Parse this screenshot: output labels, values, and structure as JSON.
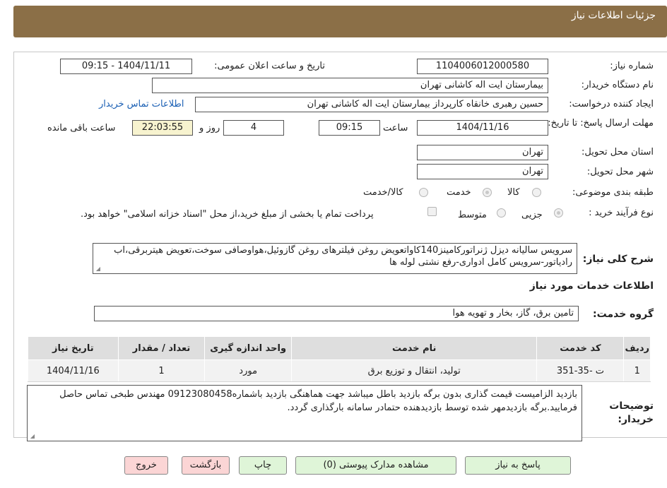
{
  "header": {
    "title": "جزئیات اطلاعات نیاز"
  },
  "form": {
    "need_number_label": "شماره نیاز:",
    "need_number": "1104006012000580",
    "announce_label": "تاریخ و ساعت اعلان عمومی:",
    "announce_value": "1404/11/11 - 09:15",
    "buyer_org_label": "نام دستگاه خریدار:",
    "buyer_org": "بیمارستان ایت اله کاشانی تهران",
    "requester_label": "ایجاد کننده درخواست:",
    "requester": "حسین رهبری خانقاه کارپرداز بیمارستان ایت اله کاشانی تهران",
    "contact_link": "اطلاعات تماس خریدار",
    "deadline_label": "مهلت ارسال پاسخ: تا تاریخ:",
    "deadline_date": "1404/11/16",
    "time_label": "ساعت",
    "deadline_time": "09:15",
    "days_value": "4",
    "days_label": "روز و",
    "remaining_time": "22:03:55",
    "remaining_label": "ساعت باقی مانده",
    "province_label": "استان محل تحویل:",
    "province": "تهران",
    "city_label": "شهر محل تحویل:",
    "city": "تهران",
    "category_label": "طبقه بندی موضوعی:",
    "category_options": [
      "کالا",
      "خدمت",
      "کالا/خدمت"
    ],
    "category_selected": "خدمت",
    "process_label": "نوع فرآیند خرید :",
    "process_options": [
      "جزیی",
      "متوسط"
    ],
    "process_selected": "جزیی",
    "payment_note": "پرداخت تمام یا بخشی از مبلغ خرید،از محل \"اسناد خزانه اسلامی\" خواهد بود.",
    "description_label": "شرح کلی نیاز:",
    "description": "سرویس سالیانه دیزل ژنراتورکامینز140کاواتعویض روغن فیلترهای روغن گازوئیل،هواوصافی سوخت،تعویض هیتربرقی،اب رادیاتور-سرویس کامل ادواری-رفع نشتی لوله ها"
  },
  "services": {
    "section_title": "اطلاعات خدمات مورد نیاز",
    "group_label": "گروه خدمت:",
    "group_value": "تامین برق، گاز، بخار و تهویه هوا",
    "columns": [
      "ردیف",
      "کد خدمت",
      "نام خدمت",
      "واحد اندازه گیری",
      "تعداد / مقدار",
      "تاریخ نیاز"
    ],
    "rows": [
      [
        "1",
        "ت -35-351",
        "تولید، انتقال و توزیع برق",
        "مورد",
        "1",
        "1404/11/16"
      ]
    ]
  },
  "notes": {
    "label": "توضیحات خریدار:",
    "text": "بازدید الزامیست قیمت گذاری بدون برگه بازدید باطل میباشد جهت هماهنگی بازدید باشماره09123080458 مهندس طبخی تماس حاصل فرمایید.برگه بازدیدمهر شده توسط بازدیدهنده حتمادر سامانه بارگذاری گردد."
  },
  "buttons": {
    "reply": "پاسخ به نیاز",
    "attachments": "مشاهده مدارک پیوستی (0)",
    "print": "چاپ",
    "back": "بازگشت",
    "exit": "خروج"
  },
  "colors": {
    "header": "#8b6f47",
    "button_green": "#dff5d8",
    "button_pink": "#fbd5d5",
    "timer_bg": "#f7f3cf"
  }
}
